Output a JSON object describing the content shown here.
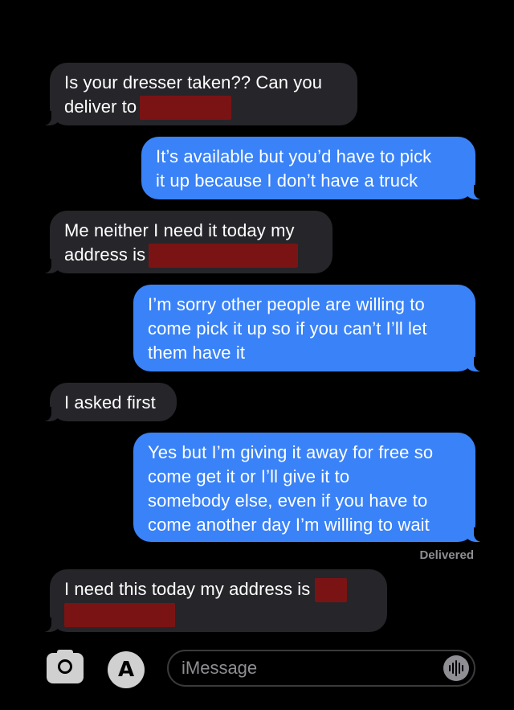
{
  "messages": [
    {
      "id": "m1",
      "direction": "incoming",
      "text_line1": "Is your dresser taken?? Can you",
      "text_line2": "deliver to"
    },
    {
      "id": "m2",
      "direction": "outgoing",
      "text_line1": "It’s available but you’d have to pick",
      "text_line2": "it up because I don’t have a truck"
    },
    {
      "id": "m3",
      "direction": "incoming",
      "text_line1": "Me neither I need it today my",
      "text_line2": "address is"
    },
    {
      "id": "m4",
      "direction": "outgoing",
      "text_line1": "I’m sorry other people are willing to",
      "text_line2": "come pick it up so if you can’t I’ll let",
      "text_line3": "them have it"
    },
    {
      "id": "m5",
      "direction": "incoming",
      "text_line1": "I asked first"
    },
    {
      "id": "m6",
      "direction": "outgoing",
      "text_line1": "Yes but I’m giving it away for free so",
      "text_line2": "come get it or I’ll give it to",
      "text_line3": "somebody else, even if you have to",
      "text_line4": "come another day I’m willing to wait"
    },
    {
      "id": "m7",
      "direction": "incoming",
      "text_line1": "I need this today my address is"
    }
  ],
  "status": "Delivered",
  "composer": {
    "placeholder": "iMessage",
    "camera_icon": "camera-icon",
    "apps_icon": "app-store-icon",
    "audio_icon": "audio-waveform-icon"
  },
  "colors": {
    "incoming_bubble": "#26252a",
    "outgoing_bubble": "#3a82f7",
    "redaction": "#7a1414",
    "background": "#000000"
  }
}
